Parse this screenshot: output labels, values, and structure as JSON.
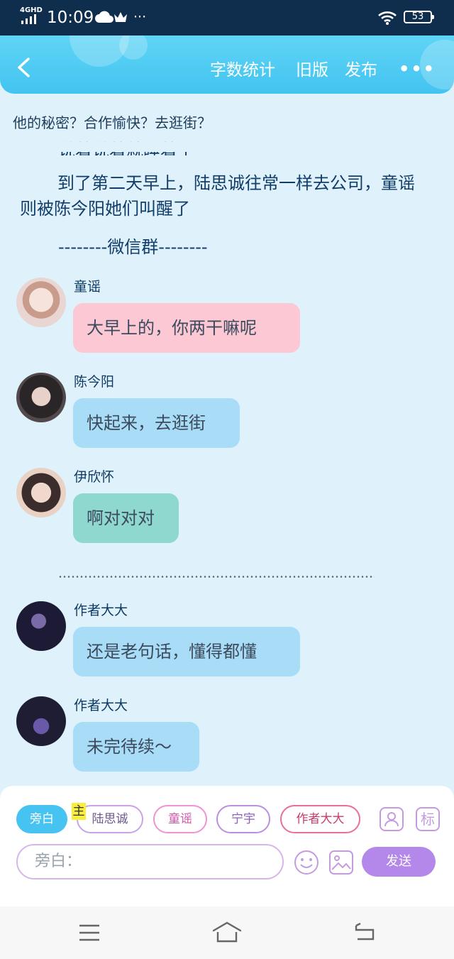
{
  "status_bar": {
    "network": "4GHD",
    "time": "10:09",
    "battery": "53"
  },
  "header": {
    "menu": [
      "字数统计",
      "旧版",
      "发布"
    ],
    "more": "•••"
  },
  "story_title": "他的秘密？合作愉快？去逛街？",
  "content": {
    "partial_line": "说着说着就睡着了",
    "paragraph": "到了第二天早上，陆思诚往常一样去公司，童谣则被陈今阳她们叫醒了",
    "separator": "--------微信群--------"
  },
  "messages": [
    {
      "speaker": "童谣",
      "text": "大早上的，你两干嘛呢",
      "bubble_color": "#fbc8d3",
      "avatar": "avatar-tongyao"
    },
    {
      "speaker": "陈今阳",
      "text": "快起来，去逛街",
      "bubble_color": "#a9dcf6",
      "avatar": "avatar-chenjinyang"
    },
    {
      "speaker": "伊欣怀",
      "text": "啊对对对",
      "bubble_color": "#8fd8cf",
      "avatar": "avatar-yixinhuai"
    },
    {
      "speaker": "作者大大",
      "text": "还是老句话，懂得都懂",
      "bubble_color": "#a9dcf6",
      "avatar": "avatar-author"
    },
    {
      "speaker": "作者大大",
      "text": "未完待续～",
      "bubble_color": "#a9dcf6",
      "avatar": "avatar-author"
    }
  ],
  "composer": {
    "roles": [
      {
        "label": "旁白",
        "selected": true
      },
      {
        "label": "陆思诚",
        "color": "#c9a3e6",
        "text_color": "#6b5a8c"
      },
      {
        "label": "童谣",
        "color": "#ef93d2",
        "text_color": "#d05aa8"
      },
      {
        "label": "宁宇",
        "color": "#b991de",
        "text_color": "#8a62b8"
      },
      {
        "label": "作者大大",
        "color": "#ea6f98",
        "text_color": "#c73d6a"
      }
    ],
    "main_tag": "主",
    "tag_button": "标",
    "input_placeholder": "旁白：",
    "send_label": "发送"
  },
  "colors": {
    "header": "#46c3f0",
    "background": "#dff2fb",
    "send": "#b487ea"
  }
}
